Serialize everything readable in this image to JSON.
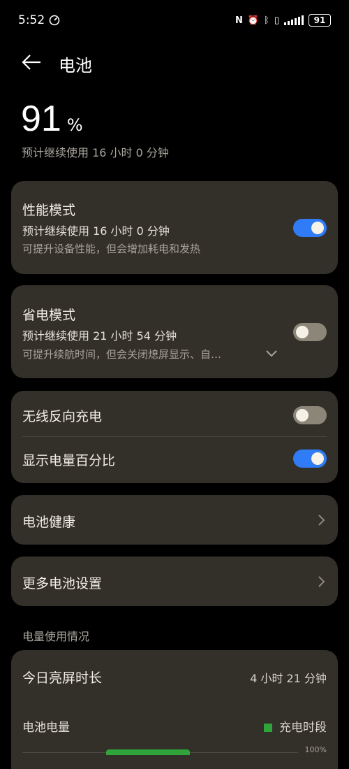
{
  "status": {
    "time": "5:52",
    "battery": "91"
  },
  "header": {
    "title": "电池"
  },
  "summary": {
    "percent": "91",
    "percent_sign": "%",
    "remaining": "预计继续使用 16 小时 0 分钟"
  },
  "performance_mode": {
    "title": "性能模式",
    "estimate": "预计继续使用 16 小时 0 分钟",
    "description": "可提升设备性能，但会增加耗电和发热",
    "enabled": true
  },
  "power_saving_mode": {
    "title": "省电模式",
    "estimate": "预计继续使用 21 小时 54 分钟",
    "description": "可提升续航时间，但会关闭熄屏显示、自…",
    "enabled": false
  },
  "toggles_group": {
    "wireless_reverse": {
      "label": "无线反向充电",
      "enabled": false
    },
    "show_percentage": {
      "label": "显示电量百分比",
      "enabled": true
    }
  },
  "battery_health": {
    "label": "电池健康"
  },
  "more_settings": {
    "label": "更多电池设置"
  },
  "usage": {
    "section_title": "电量使用情况",
    "screen_time_label": "今日亮屏时长",
    "screen_time_value": "4 小时 21 分钟",
    "battery_level_label": "电池电量",
    "legend_charging": "充电时段",
    "axis_max": "100%",
    "colors": {
      "charging": "#2fa43a"
    }
  }
}
